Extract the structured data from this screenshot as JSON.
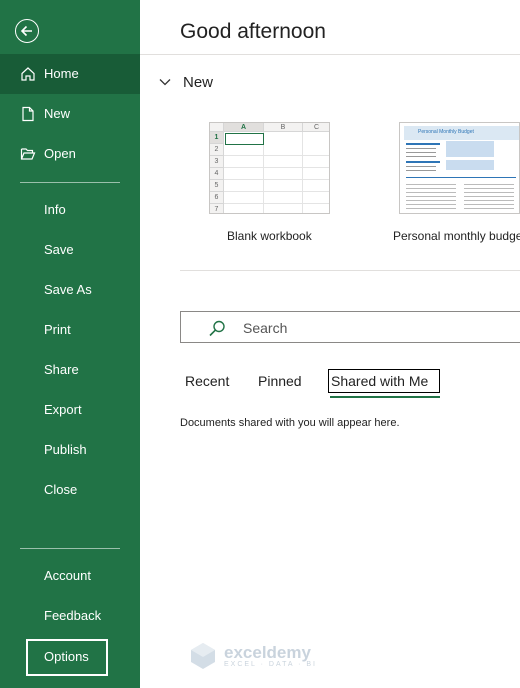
{
  "sidebar": {
    "items_top": [
      {
        "label": "Home",
        "icon": "home-icon",
        "active": true
      },
      {
        "label": "New",
        "icon": "new-file-icon"
      },
      {
        "label": "Open",
        "icon": "open-folder-icon"
      }
    ],
    "items_middle": [
      "Info",
      "Save",
      "Save As",
      "Print",
      "Share",
      "Export",
      "Publish",
      "Close"
    ],
    "items_bottom": [
      "Account",
      "Feedback",
      "Options"
    ]
  },
  "main": {
    "greeting": "Good afternoon",
    "new_section_title": "New",
    "templates": [
      {
        "label": "Blank workbook",
        "columns": [
          "A",
          "B",
          "C"
        ],
        "rows": [
          "1",
          "2",
          "3",
          "4",
          "5",
          "6",
          "7"
        ]
      },
      {
        "label": "Personal monthly budget",
        "thumb_title": "Personal Monthly Budget"
      }
    ],
    "search": {
      "placeholder": "Search"
    },
    "tabs": [
      {
        "label": "Recent"
      },
      {
        "label": "Pinned"
      },
      {
        "label": "Shared with Me",
        "selected": true
      }
    ],
    "empty_message": "Documents shared with you will appear here."
  },
  "watermark": {
    "title": "exceldemy",
    "subtitle": "EXCEL · DATA · BI"
  },
  "colors": {
    "sidebar_bg": "#217346",
    "sidebar_active": "#185c37",
    "accent": "#217346"
  }
}
